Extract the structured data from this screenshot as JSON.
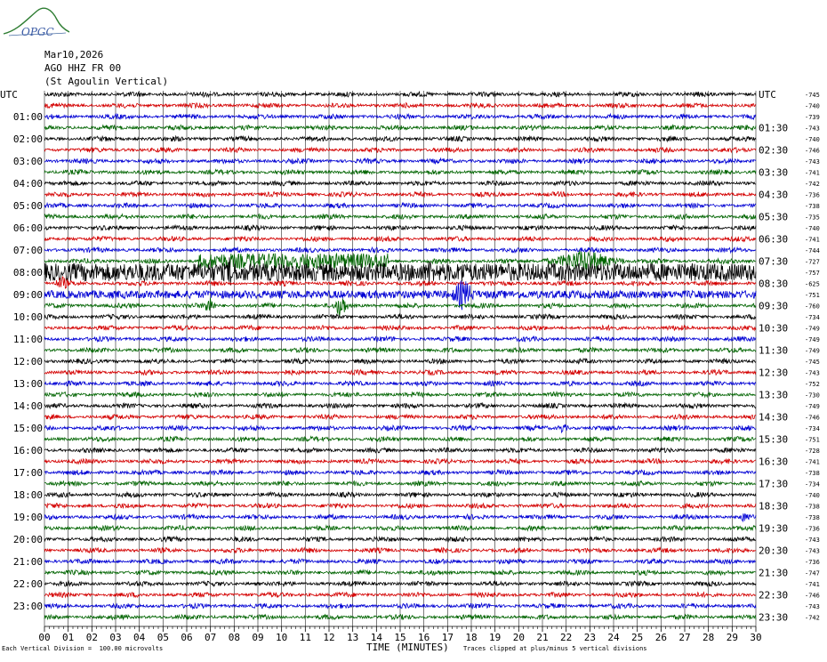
{
  "logo_text": "OPGC",
  "header": {
    "date": "Mar10,2026",
    "station": "AGO HHZ FR 00",
    "site": "(St Agoulin Vertical)"
  },
  "chart_data": {
    "type": "line",
    "title": "",
    "left_axis_label": "UTC",
    "right_axis_label": "UTC",
    "xlabel": "TIME (MINUTES)",
    "xlim": [
      0,
      30
    ],
    "x_ticks": [
      "00",
      "01",
      "02",
      "03",
      "04",
      "05",
      "06",
      "07",
      "08",
      "09",
      "10",
      "11",
      "12",
      "13",
      "14",
      "15",
      "16",
      "17",
      "18",
      "19",
      "20",
      "21",
      "22",
      "23",
      "24",
      "25",
      "26",
      "27",
      "28",
      "29",
      "30"
    ],
    "grid": true,
    "left_hour_labels": [
      "UTC",
      "01:00",
      "02:00",
      "03:00",
      "04:00",
      "05:00",
      "06:00",
      "07:00",
      "08:00",
      "09:00",
      "10:00",
      "11:00",
      "12:00",
      "13:00",
      "14:00",
      "15:00",
      "16:00",
      "17:00",
      "18:00",
      "19:00",
      "20:00",
      "21:00",
      "22:00",
      "23:00"
    ],
    "right_hour_labels": [
      "UTC",
      "01:30",
      "02:30",
      "03:30",
      "04:30",
      "05:30",
      "06:30",
      "07:30",
      "08:30",
      "09:30",
      "10:30",
      "11:30",
      "12:30",
      "13:30",
      "14:30",
      "15:30",
      "16:30",
      "17:30",
      "18:30",
      "19:30",
      "20:30",
      "21:30",
      "22:30",
      "23:30"
    ],
    "trace_colors": [
      "#000000",
      "#d40000",
      "#0000d4",
      "#006400"
    ],
    "trace_offsets": [
      "-745",
      "-740",
      "-739",
      "-743",
      "-740",
      "-746",
      "-743",
      "-741",
      "-742",
      "-736",
      "-738",
      "-735",
      "-740",
      "-741",
      "-744",
      "-727",
      "-757",
      "-625",
      "-751",
      "-760",
      "-734",
      "-749",
      "-749",
      "-749",
      "-745",
      "-743",
      "-752",
      "-730",
      "-749",
      "-746",
      "-734",
      "-751",
      "-728",
      "-741",
      "-738",
      "-734",
      "-740",
      "-738",
      "-738",
      "-736",
      "-743",
      "-743",
      "-736",
      "-747",
      "-741",
      "-746",
      "-743",
      "-742"
    ],
    "events": [
      {
        "trace": 15,
        "minute_start": 6.5,
        "minute_end": 14.5,
        "level": 0.7
      },
      {
        "trace": 15,
        "minute_start": 21.0,
        "minute_end": 24.5,
        "level": 1.1
      },
      {
        "trace": 16,
        "minute_start": 0.0,
        "minute_end": 30.0,
        "level": 0.8
      },
      {
        "trace": 16,
        "minute_start": 7.5,
        "minute_end": 8.2,
        "level": 1.6
      },
      {
        "trace": 16,
        "minute_start": 16.0,
        "minute_end": 16.5,
        "level": 1.5
      },
      {
        "trace": 16,
        "minute_start": 17.2,
        "minute_end": 18.0,
        "level": 1.3
      },
      {
        "trace": 17,
        "minute_start": 0.3,
        "minute_end": 1.2,
        "level": 0.7
      },
      {
        "trace": 18,
        "minute_start": 0.0,
        "minute_end": 30.0,
        "level": 0.35
      },
      {
        "trace": 18,
        "minute_start": 17.0,
        "minute_end": 18.3,
        "level": 1.5
      },
      {
        "trace": 19,
        "minute_start": 6.7,
        "minute_end": 7.2,
        "level": 1.2
      },
      {
        "trace": 19,
        "minute_start": 12.2,
        "minute_end": 12.8,
        "level": 1.4
      },
      {
        "trace": 30,
        "minute_start": 21.5,
        "minute_end": 22.2,
        "level": 0.5
      },
      {
        "trace": 38,
        "minute_start": 29.2,
        "minute_end": 29.8,
        "level": 0.5
      }
    ]
  },
  "footer": {
    "scale_note": "Each Vertical Division =  100.00 microvolts",
    "clip_note": "Traces clipped at plus/minus 5 vertical divisions"
  }
}
